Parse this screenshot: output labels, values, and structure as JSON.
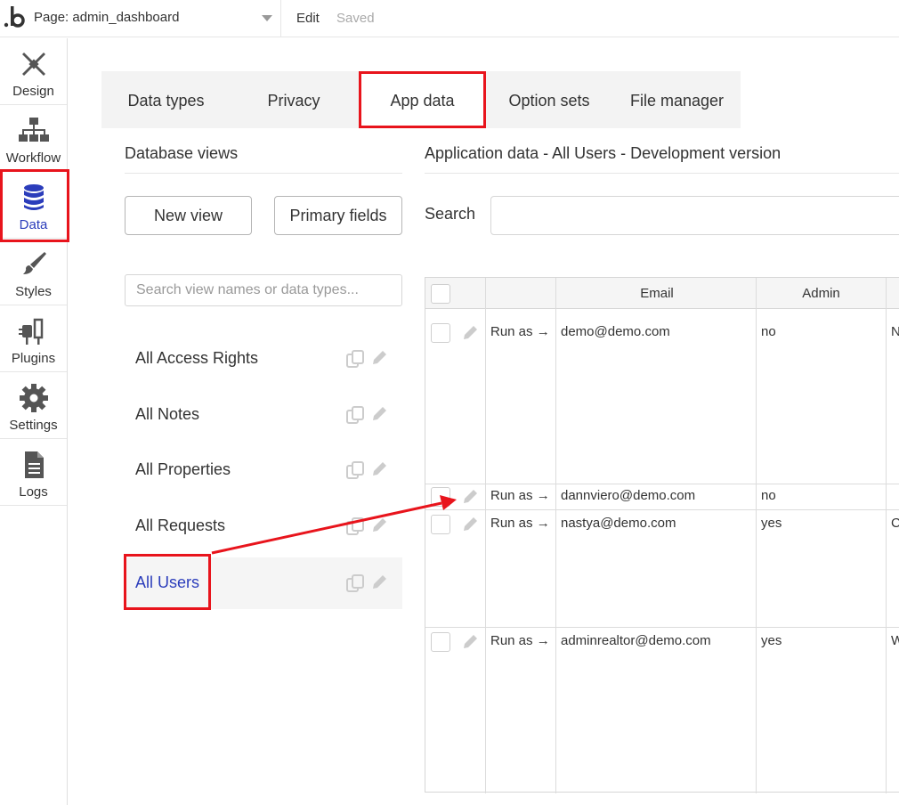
{
  "topbar": {
    "page_label": "Page: admin_dashboard",
    "edit_label": "Edit",
    "saved_label": "Saved"
  },
  "nav": {
    "items": [
      {
        "label": "Design",
        "icon": "design-icon"
      },
      {
        "label": "Workflow",
        "icon": "workflow-icon"
      },
      {
        "label": "Data",
        "icon": "database-icon",
        "active": true
      },
      {
        "label": "Styles",
        "icon": "brush-icon"
      },
      {
        "label": "Plugins",
        "icon": "plug-icon"
      },
      {
        "label": "Settings",
        "icon": "gear-icon"
      },
      {
        "label": "Logs",
        "icon": "document-icon"
      }
    ]
  },
  "tabs": [
    {
      "label": "Data types"
    },
    {
      "label": "Privacy"
    },
    {
      "label": "App data",
      "active": true
    },
    {
      "label": "Option sets"
    },
    {
      "label": "File manager"
    }
  ],
  "views_panel": {
    "title": "Database views",
    "new_view_label": "New view",
    "primary_fields_label": "Primary fields",
    "search_placeholder": "Search view names or data types...",
    "views": [
      {
        "label": "All Access Rights"
      },
      {
        "label": "All Notes"
      },
      {
        "label": "All Properties"
      },
      {
        "label": "All Requests"
      },
      {
        "label": "All Users",
        "active": true
      }
    ]
  },
  "data_panel": {
    "title": "Application data - All Users - Development version",
    "search_label": "Search",
    "columns": [
      "Email",
      "Admin"
    ],
    "rows": [
      {
        "run_as": "Run as →",
        "email": "demo@demo.com",
        "admin": "no",
        "extra": "N"
      },
      {
        "run_as": "Run as →",
        "email": "dannviero@demo.com",
        "admin": "no",
        "extra": ""
      },
      {
        "run_as": "Run as →",
        "email": "nastya@demo.com",
        "admin": "yes",
        "extra": "C"
      },
      {
        "run_as": "Run as →",
        "email": "adminrealtor@demo.com",
        "admin": "yes",
        "extra": "W"
      }
    ]
  },
  "colors": {
    "accent": "#2b3dbb",
    "highlight": "#e8141c"
  }
}
